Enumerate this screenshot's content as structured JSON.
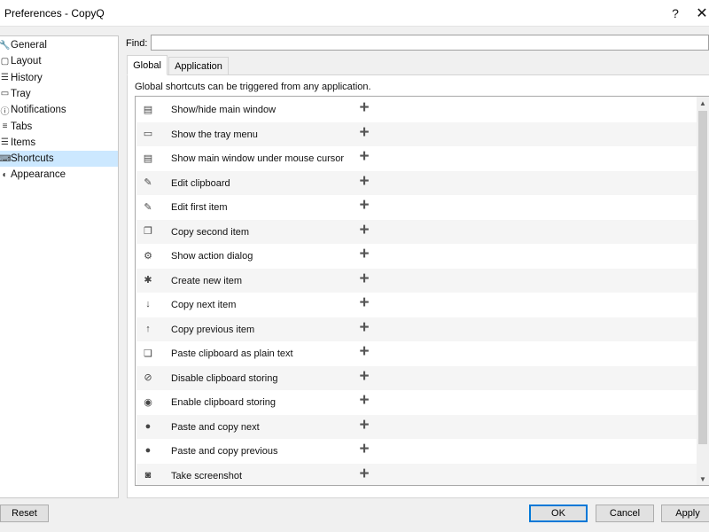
{
  "window": {
    "title": "Preferences - CopyQ",
    "help_glyph": "?",
    "close_glyph": "✕"
  },
  "sidebar": {
    "items": [
      {
        "label": "General",
        "icon": "wrench-icon",
        "glyph": "🔧"
      },
      {
        "label": "Layout",
        "icon": "layout-icon",
        "glyph": "▢"
      },
      {
        "label": "History",
        "icon": "list-icon",
        "glyph": "☰"
      },
      {
        "label": "Tray",
        "icon": "inbox-icon",
        "glyph": "▭"
      },
      {
        "label": "Notifications",
        "icon": "info-icon",
        "glyph": "ⓘ"
      },
      {
        "label": "Tabs",
        "icon": "tabs-icon",
        "glyph": "≡"
      },
      {
        "label": "Items",
        "icon": "items-icon",
        "glyph": "☰"
      },
      {
        "label": "Shortcuts",
        "icon": "keyboard-icon",
        "glyph": "⌨"
      },
      {
        "label": "Appearance",
        "icon": "palette-icon",
        "glyph": "◐"
      }
    ],
    "selected": "Shortcuts"
  },
  "find": {
    "label": "Find:",
    "value": "",
    "placeholder": ""
  },
  "tabs": [
    {
      "label": "Global",
      "active": true
    },
    {
      "label": "Application",
      "active": false
    }
  ],
  "hint": "Global shortcuts can be triggered from any application.",
  "shortcuts": [
    {
      "label": "Show/hide main window",
      "icon": "window-icon",
      "glyph": "▤"
    },
    {
      "label": "Show the tray menu",
      "icon": "tray-icon",
      "glyph": "▭"
    },
    {
      "label": "Show main window under mouse cursor",
      "icon": "window-icon",
      "glyph": "▤"
    },
    {
      "label": "Edit clipboard",
      "icon": "edit-icon",
      "glyph": "✎"
    },
    {
      "label": "Edit first item",
      "icon": "edit-icon",
      "glyph": "✎"
    },
    {
      "label": "Copy second item",
      "icon": "copy-icon",
      "glyph": "❐"
    },
    {
      "label": "Show action dialog",
      "icon": "gear-icon",
      "glyph": "⚙"
    },
    {
      "label": "Create new item",
      "icon": "asterisk-icon",
      "glyph": "✱"
    },
    {
      "label": "Copy next item",
      "icon": "arrow-down-icon",
      "glyph": "↓"
    },
    {
      "label": "Copy previous item",
      "icon": "arrow-up-icon",
      "glyph": "↑"
    },
    {
      "label": "Paste clipboard as plain text",
      "icon": "paste-icon",
      "glyph": "❏"
    },
    {
      "label": "Disable clipboard storing",
      "icon": "eye-slash-icon",
      "glyph": "⊘"
    },
    {
      "label": "Enable clipboard storing",
      "icon": "eye-icon",
      "glyph": "◉"
    },
    {
      "label": "Paste and copy next",
      "icon": "circle-arrow-down-icon",
      "glyph": "●"
    },
    {
      "label": "Paste and copy previous",
      "icon": "circle-arrow-up-icon",
      "glyph": "●"
    },
    {
      "label": "Take screenshot",
      "icon": "camera-icon",
      "glyph": "◙"
    }
  ],
  "add_glyph": "+",
  "scroll": {
    "up_glyph": "▲",
    "down_glyph": "▼"
  },
  "buttons": {
    "reset": "Reset",
    "ok": "OK",
    "cancel": "Cancel",
    "apply": "Apply"
  },
  "colors": {
    "selection": "#cce8ff",
    "default_button_border": "#0078d7"
  }
}
